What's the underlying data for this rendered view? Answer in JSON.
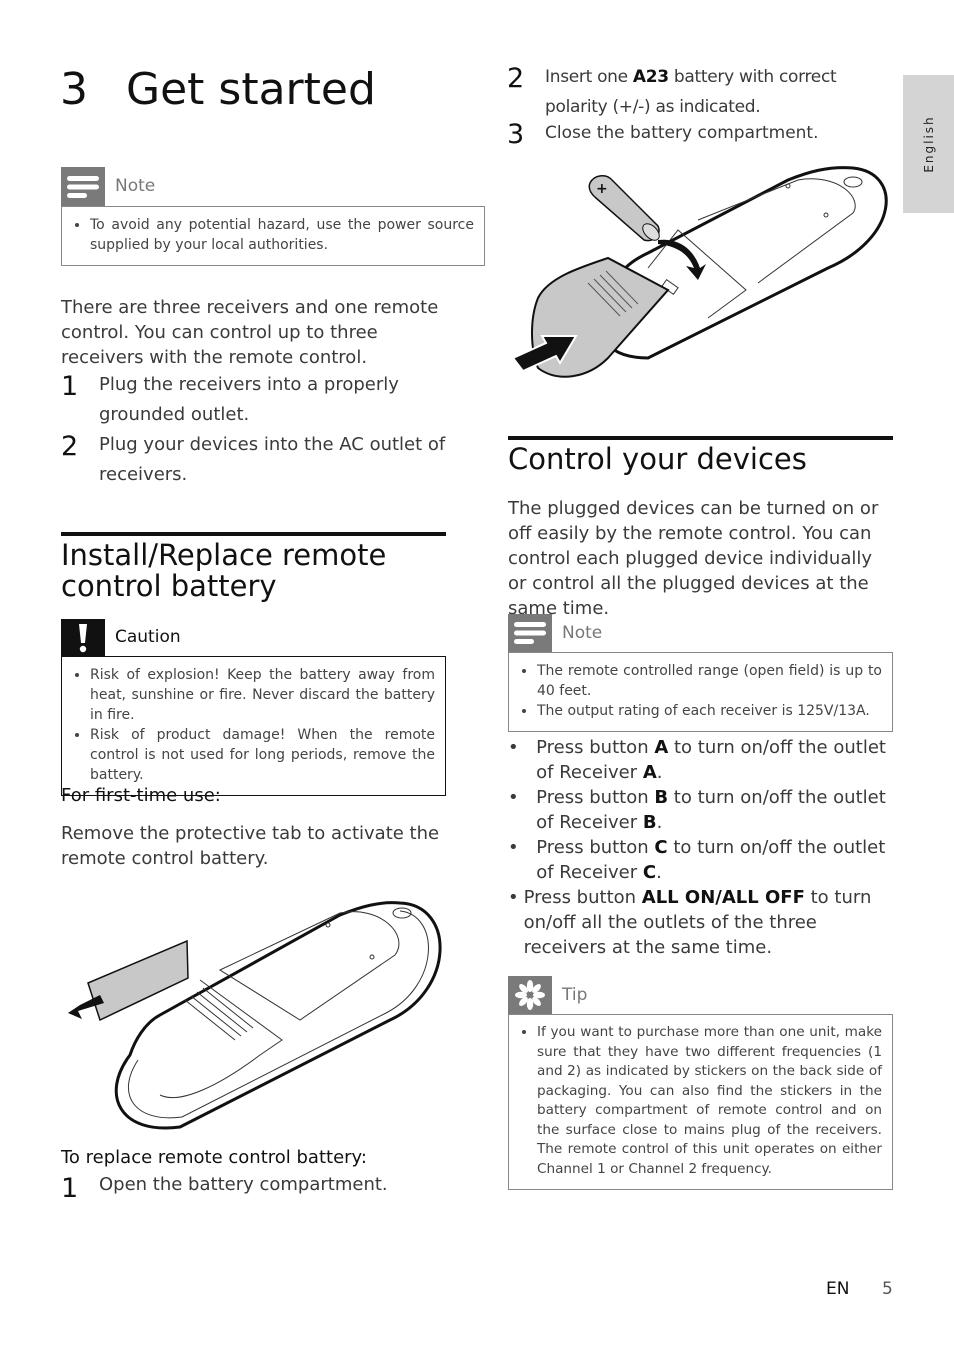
{
  "chapter": {
    "number": "3",
    "title": "Get started"
  },
  "side_tab": {
    "label": "English"
  },
  "left_column": {
    "note1": {
      "header": "Note",
      "icon": "note-lines-icon",
      "items": [
        "To avoid any potential hazard, use the power source supplied by your local authorities."
      ]
    },
    "intro": "There are three receivers and one remote control. You can control up to three receivers with the remote control.",
    "steps": [
      {
        "num": "1",
        "text": "Plug the receivers into a properly grounded outlet."
      },
      {
        "num": "2",
        "text": "Plug your devices into the AC outlet of receivers."
      }
    ],
    "section_title": "Install/Replace remote control battery",
    "caution": {
      "header": "Caution",
      "icon": "exclamation-icon",
      "items": [
        "Risk of explosion! Keep the battery away from heat, sunshine or fire. Never discard the battery in fire.",
        "Risk of product damage! When the remote control is not used for long periods, remove the battery."
      ]
    },
    "first_use_heading": "For first-time use:",
    "first_use_text": "Remove the protective tab to activate the remote control battery.",
    "illustration1": "remote-control-remove-tab-illustration",
    "replace_heading": "To replace remote control battery:",
    "replace_steps": [
      {
        "num": "1",
        "text": "Open the battery compartment."
      }
    ]
  },
  "right_column": {
    "steps": [
      {
        "num": "2",
        "pre": "Insert one ",
        "bold": "A23",
        "post": " battery with correct polarity (+/-) as indicated."
      },
      {
        "num": "3",
        "text": "Close the battery compartment."
      }
    ],
    "illustration2": "remote-control-insert-battery-illustration",
    "section_title": "Control your devices",
    "intro": "The plugged devices can be turned on or off easily by the remote control. You can control each plugged device individually or control all the plugged devices at the same time.",
    "note2": {
      "header": "Note",
      "icon": "note-lines-icon",
      "items": [
        "The remote controlled range (open field) is up to 40 feet.",
        "The output rating of each receiver is 125V/13A."
      ]
    },
    "bullets": [
      {
        "pre": "Press button ",
        "b1": "A",
        "mid": " to turn on/off the outlet of Receiver ",
        "b2": "A",
        "post": "."
      },
      {
        "pre": "Press button ",
        "b1": "B",
        "mid": " to turn on/off the outlet of Receiver ",
        "b2": "B",
        "post": "."
      },
      {
        "pre": "Press button ",
        "b1": "C",
        "mid": " to turn on/off the outlet of Receiver ",
        "b2": "C",
        "post": "."
      },
      {
        "pre": "Press button ",
        "b1": "ALL ON/ALL OFF",
        "mid": " to turn on/off all the outlets of the three receivers at the same time.",
        "b2": "",
        "post": ""
      }
    ],
    "tip": {
      "header": "Tip",
      "icon": "asterisk-tip-icon",
      "items": [
        "If you want to purchase more than one unit, make sure that they have two different frequencies (1 and 2) as indicated by stickers on the back side of packaging. You can also find the stickers in the battery compartment of remote control and on the surface close to mains plug of the receivers. The remote control of this unit operates on either Channel 1 or Channel 2 frequency."
      ]
    }
  },
  "footer": {
    "lang": "EN",
    "page": "5"
  },
  "colors": {
    "header_gray": "#7a7a7a",
    "caution_black": "#111111",
    "side_tab": "#d4d4d4"
  }
}
